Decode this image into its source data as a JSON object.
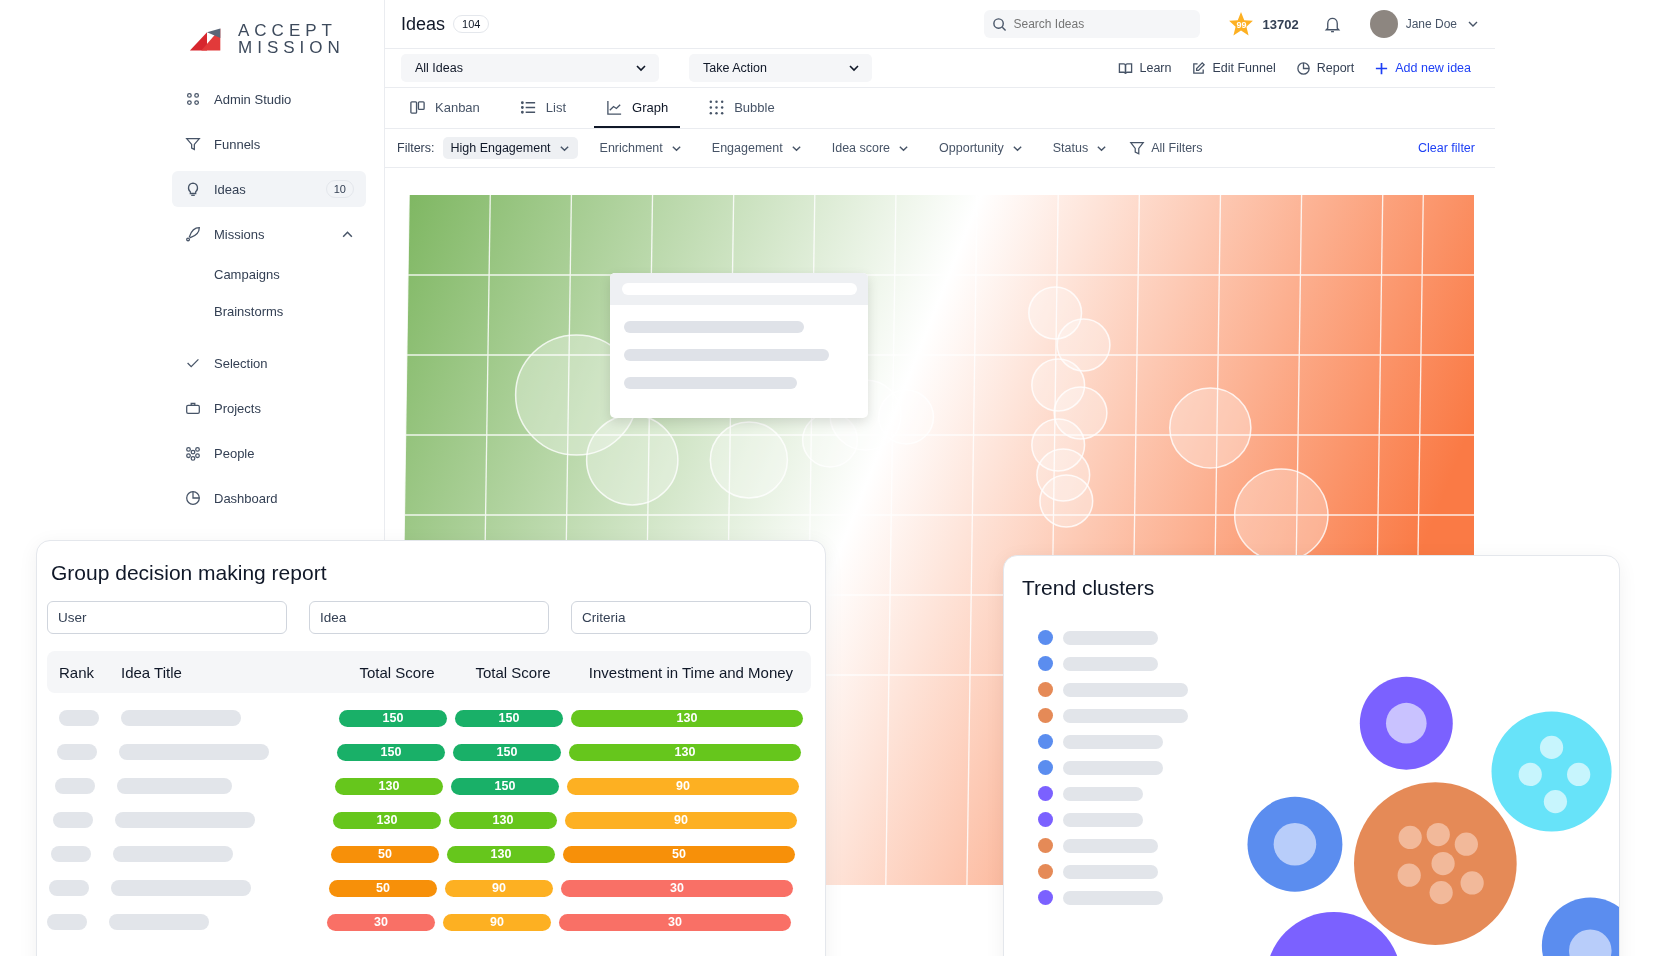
{
  "sidebar": {
    "logo": {
      "line_1": "ACCEPT",
      "line_2": "MISSION"
    },
    "items": [
      {
        "label": "Admin Studio",
        "selected": false
      },
      {
        "label": "Funnels",
        "selected": false
      },
      {
        "label": "Ideas",
        "badge": "10",
        "selected": true
      },
      {
        "label": "Missions",
        "selected": false,
        "expanded": true,
        "children": [
          {
            "label": "Campaigns"
          },
          {
            "label": "Brainstorms"
          }
        ]
      },
      {
        "label": "Selection",
        "selected": false
      },
      {
        "label": "Projects",
        "selected": false
      },
      {
        "label": "People",
        "selected": false
      },
      {
        "label": "Dashboard",
        "selected": false
      }
    ]
  },
  "header": {
    "title": "Ideas",
    "count": "104",
    "search": {
      "placeholder": "Search Ideas"
    },
    "points_badge": "99",
    "points": "13702",
    "user": "Jane Doe"
  },
  "toolbar": {
    "dropdowns": [
      "All Ideas",
      "Take Action"
    ],
    "actions": [
      {
        "label": "Learn",
        "primary": false
      },
      {
        "label": "Edit Funnel",
        "primary": false
      },
      {
        "label": "Report",
        "primary": false
      },
      {
        "label": "Add new idea",
        "primary": true
      }
    ]
  },
  "tabs": [
    {
      "label": "Kanban",
      "selected": false
    },
    {
      "label": "List",
      "selected": false
    },
    {
      "label": "Graph",
      "selected": true
    },
    {
      "label": "Bubble",
      "selected": false
    }
  ],
  "filters": {
    "label": "Filters:",
    "items": [
      {
        "label": "High Engagement",
        "selected": true
      },
      {
        "label": "Enrichment",
        "selected": false
      },
      {
        "label": "Engagement",
        "selected": false
      },
      {
        "label": "Idea score",
        "selected": false
      },
      {
        "label": "Opportunity",
        "selected": false
      },
      {
        "label": "Status",
        "selected": false
      }
    ],
    "all_filters": "All Filters",
    "clear": "Clear filter"
  },
  "report": {
    "title": "Group decision making report",
    "fields": [
      {
        "placeholder": "User"
      },
      {
        "placeholder": "Idea"
      },
      {
        "placeholder": "Criteria"
      }
    ],
    "columns": [
      "Rank",
      "Idea Title",
      "Total Score",
      "Total Score",
      "Investment in Time and Money"
    ],
    "rows": [
      {
        "scores": [
          {
            "value": "150",
            "color": "#19b068"
          },
          {
            "value": "150",
            "color": "#19b068"
          },
          {
            "value": "130",
            "color": "#66c61c"
          }
        ]
      },
      {
        "scores": [
          {
            "value": "150",
            "color": "#19b068"
          },
          {
            "value": "150",
            "color": "#19b068"
          },
          {
            "value": "130",
            "color": "#66c61c"
          }
        ]
      },
      {
        "scores": [
          {
            "value": "130",
            "color": "#66c61c"
          },
          {
            "value": "150",
            "color": "#19b068"
          },
          {
            "value": "90",
            "color": "#fdb022"
          }
        ]
      },
      {
        "scores": [
          {
            "value": "130",
            "color": "#66c61c"
          },
          {
            "value": "130",
            "color": "#66c61c"
          },
          {
            "value": "90",
            "color": "#fdb022"
          }
        ]
      },
      {
        "scores": [
          {
            "value": "50",
            "color": "#f79009"
          },
          {
            "value": "130",
            "color": "#66c61c"
          },
          {
            "value": "50",
            "color": "#f79009"
          }
        ]
      },
      {
        "scores": [
          {
            "value": "50",
            "color": "#f79009"
          },
          {
            "value": "90",
            "color": "#fdb022"
          },
          {
            "value": "30",
            "color": "#f97066"
          }
        ]
      },
      {
        "scores": [
          {
            "value": "30",
            "color": "#f97066"
          },
          {
            "value": "90",
            "color": "#fdb022"
          },
          {
            "value": "30",
            "color": "#f97066"
          }
        ]
      }
    ]
  },
  "trends": {
    "title": "Trend clusters",
    "legend": [
      {
        "color": "#5b8def"
      },
      {
        "color": "#5b8def"
      },
      {
        "color": "#e58a57"
      },
      {
        "color": "#e58a57"
      },
      {
        "color": "#5b8def"
      },
      {
        "color": "#5b8def"
      },
      {
        "color": "#7b61ff"
      },
      {
        "color": "#7b61ff"
      },
      {
        "color": "#e58a57"
      },
      {
        "color": "#e58a57"
      },
      {
        "color": "#7b61ff"
      }
    ]
  }
}
